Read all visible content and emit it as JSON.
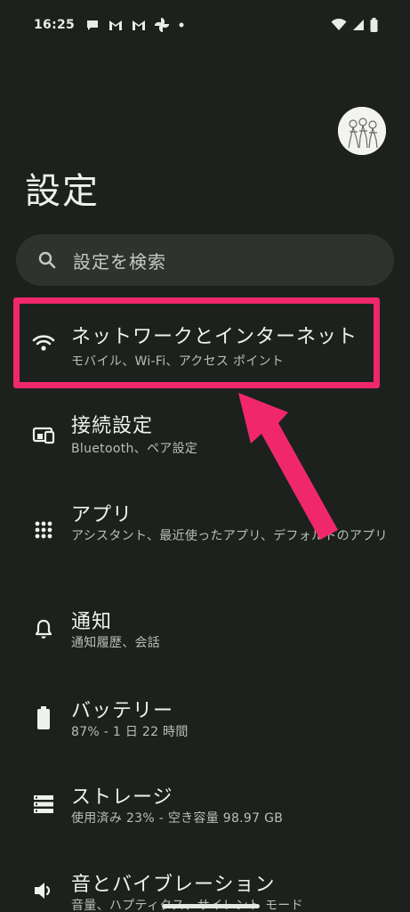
{
  "status_bar": {
    "time": "16:25",
    "notification_icons": [
      "chat-icon",
      "gmail-icon",
      "gmail-icon",
      "pinwheel-icon",
      "dot-icon"
    ],
    "right_icons": [
      "wifi-icon",
      "signal-icon",
      "battery-icon"
    ]
  },
  "header": {
    "title": "設定"
  },
  "search": {
    "placeholder": "設定を検索"
  },
  "settings_items": [
    {
      "title": "ネットワークとインターネット",
      "subtitle": "モバイル、Wi-Fi、アクセス ポイント",
      "icon": "wifi-icon"
    },
    {
      "title": "接続設定",
      "subtitle": "Bluetooth、ペア設定",
      "icon": "connected-devices-icon"
    },
    {
      "title": "アプリ",
      "subtitle": "アシスタント、最近使ったアプリ、デフォルトのアプリ",
      "icon": "apps-grid-icon"
    },
    {
      "title": "通知",
      "subtitle": "通知履歴、会話",
      "icon": "bell-icon"
    },
    {
      "title": "バッテリー",
      "subtitle": "87% - 1 日 22 時間",
      "icon": "battery-icon"
    },
    {
      "title": "ストレージ",
      "subtitle": "使用済み 23% - 空き容量 98.97 GB",
      "icon": "storage-icon"
    },
    {
      "title": "音とバイブレーション",
      "subtitle": "音量、ハプティクス、サイレント モード",
      "icon": "volume-icon"
    }
  ],
  "annotation": {
    "color": "#f0286b"
  },
  "colors": {
    "background": "#1d211d",
    "search_background": "#2e332e",
    "text_primary": "#eef1ec",
    "text_secondary": "#b9beb7"
  }
}
